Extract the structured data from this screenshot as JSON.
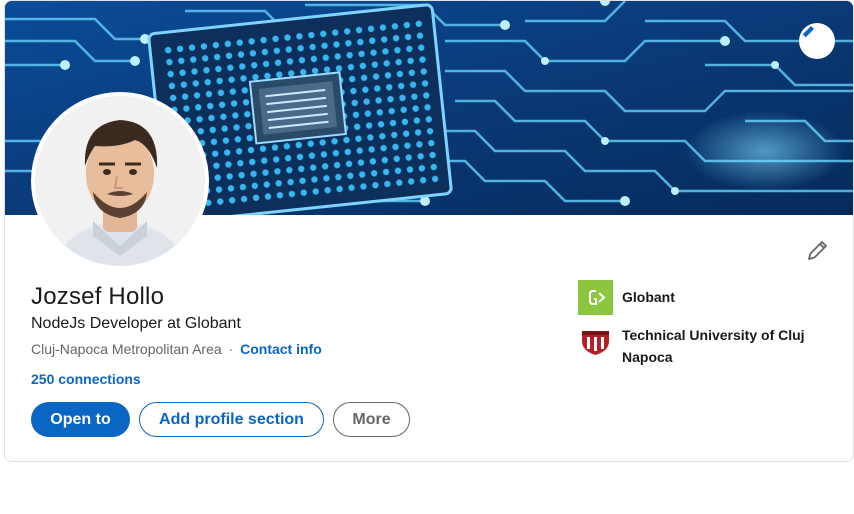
{
  "profile": {
    "name": "Jozsef Hollo",
    "headline": "NodeJs Developer at Globant",
    "location": "Cluj-Napoca Metropolitan Area",
    "separator": "·",
    "contact_info": "Contact info",
    "connections": "250 connections"
  },
  "actions": {
    "open_to": "Open to",
    "add_profile_section": "Add profile section",
    "more": "More"
  },
  "experience": [
    {
      "name": "Globant",
      "logo": "globant-logo"
    },
    {
      "name": "Technical University of Cluj Napoca",
      "logo": "university-crest-logo"
    }
  ],
  "icons": {
    "banner_edit": "pencil-icon",
    "intro_edit": "pencil-icon"
  },
  "colors": {
    "accent": "#0a66c2",
    "text_primary": "#191919",
    "text_secondary": "#666666",
    "globant_green": "#8cc63e",
    "banner_blue": "#0a3a78"
  }
}
